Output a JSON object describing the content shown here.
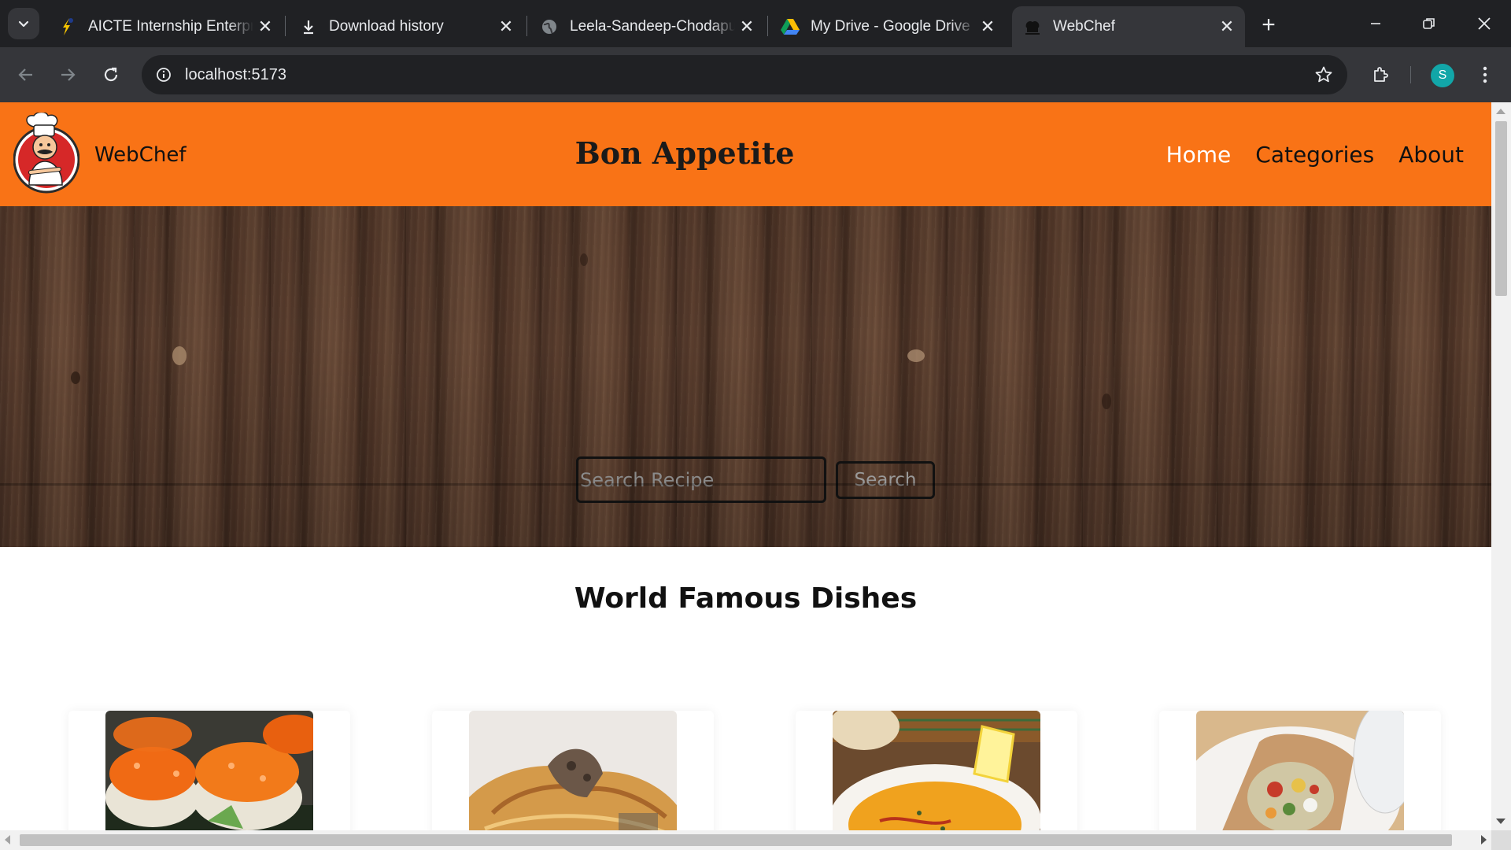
{
  "browser": {
    "tabs": [
      {
        "title": "AICTE Internship Enterprise",
        "icon": "aicte-favicon-icon",
        "active": false
      },
      {
        "title": "Download history",
        "icon": "download-icon",
        "active": false
      },
      {
        "title": "Leela-Sandeep-Chodapu",
        "icon": "globe-icon",
        "active": false
      },
      {
        "title": "My Drive - Google Drive",
        "icon": "google-drive-icon",
        "active": false
      },
      {
        "title": "WebChef",
        "icon": "webchef-favicon-icon",
        "active": true
      }
    ],
    "close_glyph": "✕",
    "new_tab_glyph": "+",
    "url": "localhost:5173",
    "profile_initial": "S",
    "colors": {
      "chrome_dark": "#202124",
      "chrome_toolbar": "#35363a",
      "avatar": "#12a6a8"
    }
  },
  "site": {
    "brand": "WebChef",
    "title": "Bon Appetite",
    "nav": [
      {
        "label": "Home",
        "active": true
      },
      {
        "label": "Categories",
        "active": false
      },
      {
        "label": "About",
        "active": false
      }
    ],
    "search": {
      "placeholder": "Search Recipe",
      "value": "",
      "button_label": "Search"
    },
    "section_title": "World Famous Dishes",
    "dishes": [
      {
        "image": "salmon-roe-sushi"
      },
      {
        "image": "meat-pastry-pie"
      },
      {
        "image": "lentil-soup-with-lemon"
      },
      {
        "image": "stuffed-flatbread-wrap"
      }
    ],
    "colors": {
      "header": "#f97316",
      "nav_active": "#ffffff",
      "text": "#111111"
    }
  }
}
